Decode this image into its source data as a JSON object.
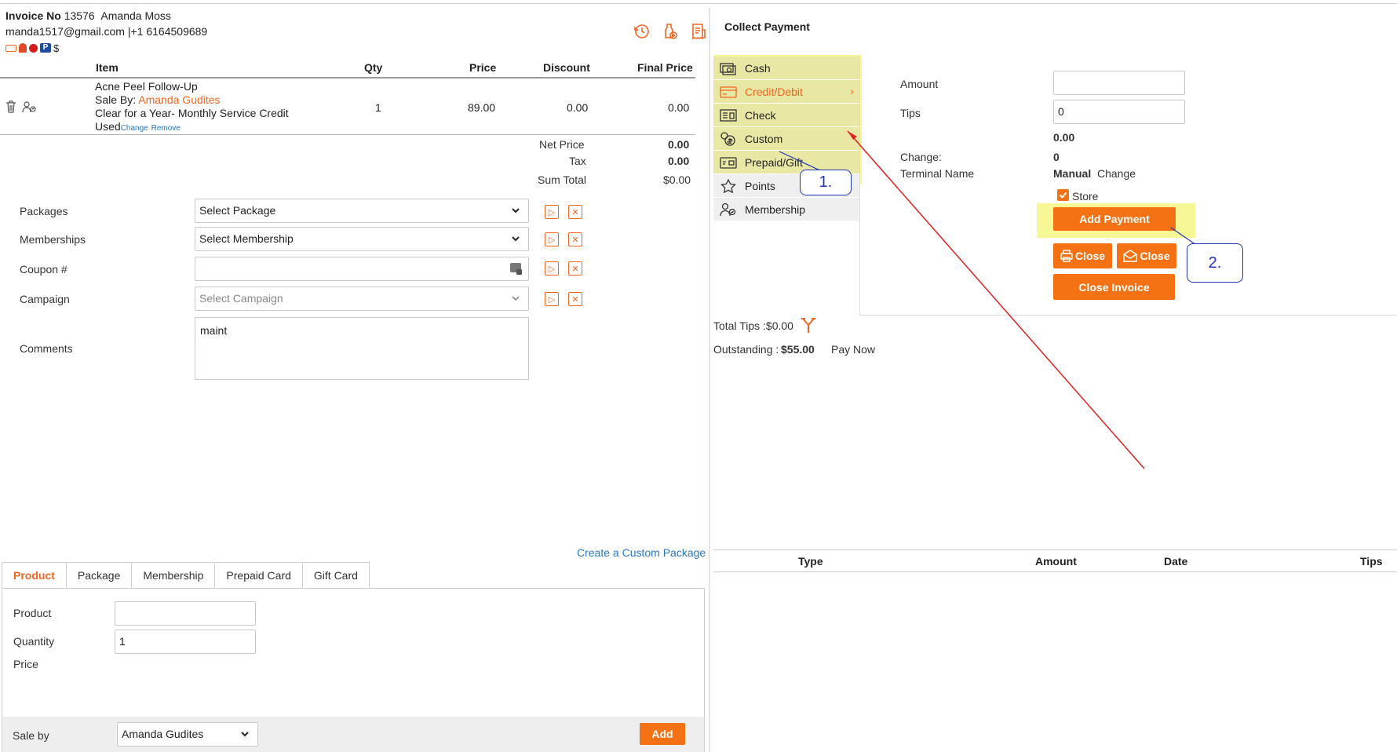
{
  "invoice": {
    "label": "Invoice No",
    "number": "13576",
    "customer": "Amanda Moss",
    "email": "manda1517@gmail.com",
    "separator": "|",
    "phone": "+1 6164509689",
    "dollar": "$"
  },
  "header_icons": [
    "history-icon",
    "add-product-icon",
    "receipt-icon"
  ],
  "items_table": {
    "headers": [
      "Item",
      "Qty",
      "Price",
      "Discount",
      "Final Price"
    ],
    "row": {
      "name": "Acne Peel Follow-Up",
      "sale_by_label": "Sale By:",
      "sale_by": "Amanda Gudites",
      "note": "Clear for a Year- Monthly Service Credit",
      "used": "Used",
      "change": "Change",
      "remove": "Remove",
      "qty": "1",
      "price": "89.00",
      "discount": "0.00",
      "final": "0.00"
    }
  },
  "totals": {
    "net_label": "Net Price",
    "net": "0.00",
    "tax_label": "Tax",
    "tax": "0.00",
    "sum_label": "Sum Total",
    "sum": "$0.00"
  },
  "form": {
    "packages_label": "Packages",
    "packages_value": "Select Package",
    "memberships_label": "Memberships",
    "memberships_value": "Select Membership",
    "coupon_label": "Coupon #",
    "coupon_value": "",
    "campaign_label": "Campaign",
    "campaign_value": "Select Campaign",
    "comments_label": "Comments",
    "comments_value": "maint"
  },
  "create_custom_package": "Create a Custom Package",
  "tabs": [
    "Product",
    "Package",
    "Membership",
    "Prepaid Card",
    "Gift Card"
  ],
  "product_panel": {
    "product_label": "Product",
    "product_value": "",
    "quantity_label": "Quantity",
    "quantity_value": "1",
    "price_label": "Price",
    "sale_by_label": "Sale by",
    "sale_by_value": "Amanda Gudites",
    "add_label": "Add"
  },
  "collect_payment": {
    "title": "Collect Payment",
    "methods": [
      "Cash",
      "Credit/Debit",
      "Check",
      "Custom",
      "Prepaid/Gift",
      "Points",
      "Membership"
    ],
    "amount_label": "Amount",
    "amount_value": "",
    "tips_label": "Tips",
    "tips_value": "0",
    "computed": "0.00",
    "change_label": "Change:",
    "change_value": "0",
    "terminal_label": "Terminal Name",
    "terminal_value": "Manual",
    "terminal_change": "Change",
    "store_label": "Store",
    "add_payment": "Add Payment",
    "close_print": "Close",
    "close_email": "Close",
    "close_invoice": "Close Invoice",
    "total_tips": "Total Tips :$0.00",
    "outstanding_label": "Outstanding :",
    "outstanding_value": "$55.00",
    "pay_now": "Pay Now"
  },
  "callouts": {
    "one": "1.",
    "two": "2."
  },
  "payments_table": {
    "headers": [
      "Type",
      "Amount",
      "Date",
      "Tips"
    ]
  },
  "colors": {
    "accent": "#f26522",
    "button": "#f47214",
    "link": "#2a78c6",
    "highlight": "#f5f57a",
    "annotation_arrow": "#e02020",
    "callout": "#2233bb"
  }
}
